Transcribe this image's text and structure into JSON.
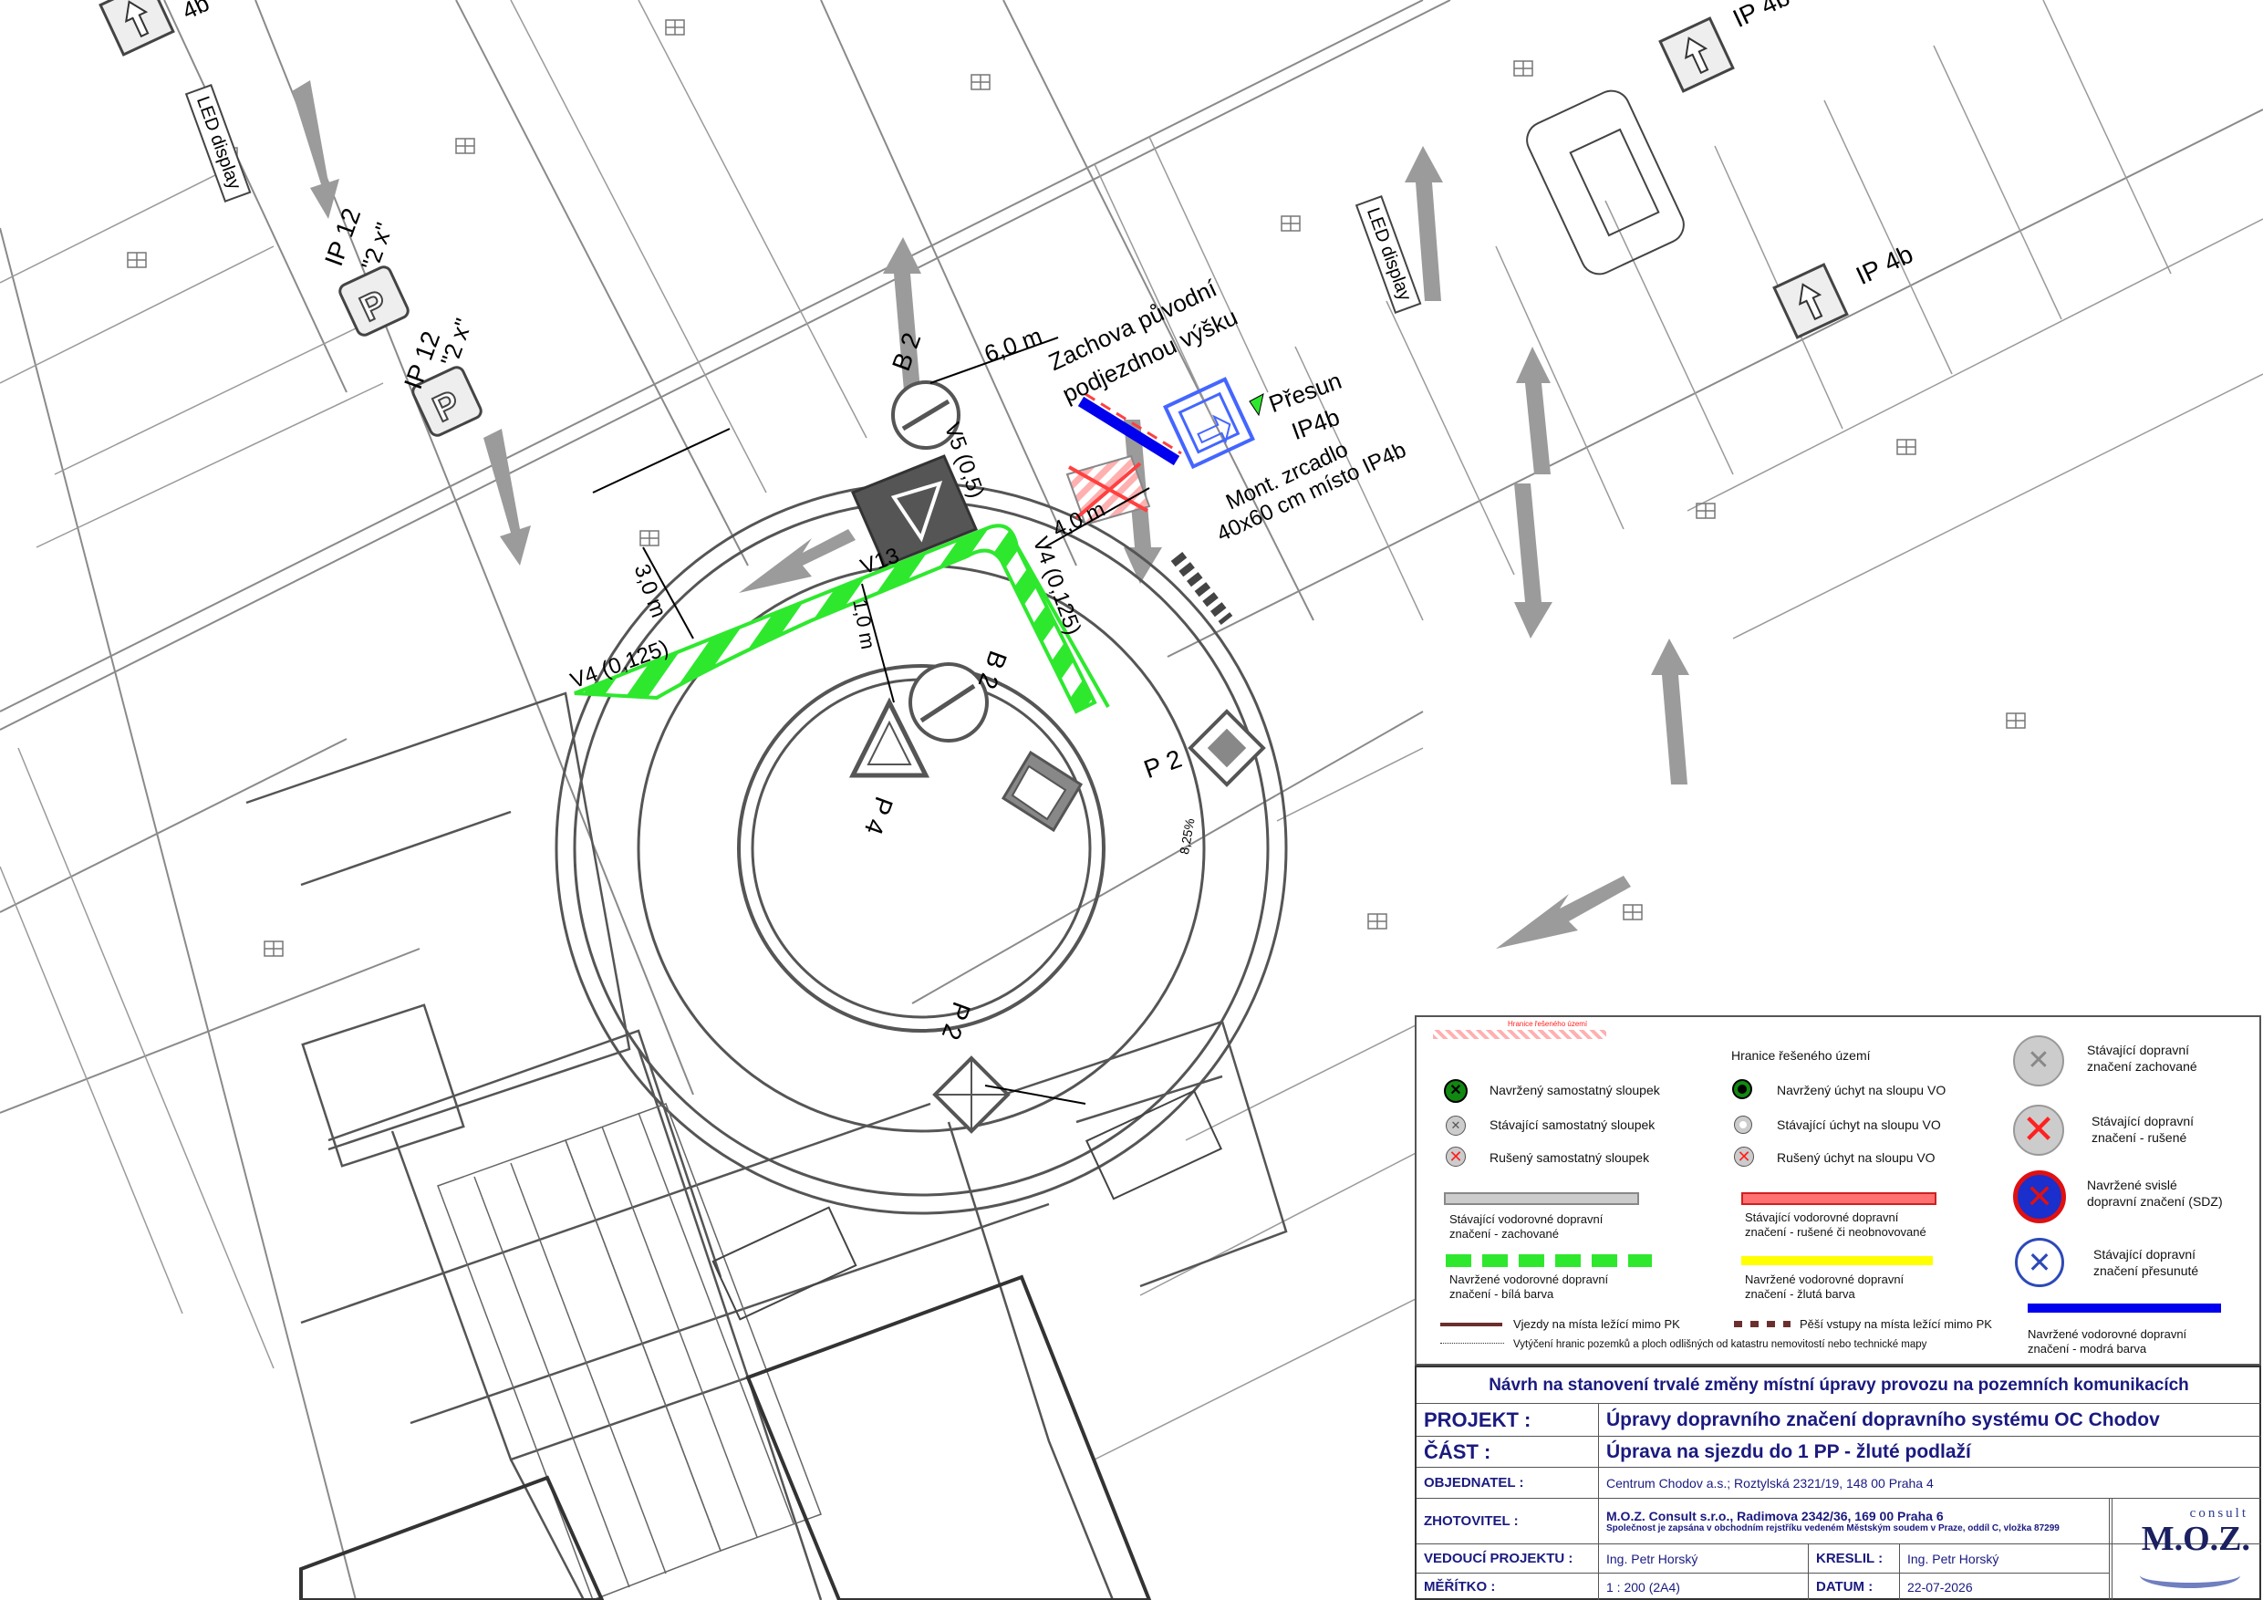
{
  "plan": {
    "signs": {
      "ip4b_a": "IP 4b",
      "ip4b_b": "IP 4b",
      "ip4b_c": "4b",
      "led_a": "LED display",
      "led_b": "LED display",
      "ip12_a": "IP 12",
      "ip12_a_qty": "\"2 x\"",
      "ip12_b": "IP 12",
      "ip12_b_qty": "\"2 x\"",
      "b2_a": "B 2",
      "b2_b": "B 2",
      "p2_a": "P 2",
      "p2_b": "P 2",
      "p4": "P 4",
      "slope": "8,25%"
    },
    "annotations": {
      "dim_6m": "6,0 m",
      "keep_height_1": "Zachova původní",
      "keep_height_2": "podjezdnou výšku",
      "move_1": "Přesun",
      "move_2": "IP4b",
      "mirror_1": "Mont. zrcadlo",
      "mirror_2": "40x60 cm místo IP4b",
      "dim_4m": "4,0 m",
      "v5": "V5 (0,5)",
      "v13": "V13",
      "dim_3m": "3,0 m",
      "dim_1m": "1,0 m",
      "v4_left": "V4 (0,125)",
      "v4_right": "V4 (0,125)"
    }
  },
  "legend": {
    "boundary_small": "Hranice řešeného území",
    "boundary": "Hranice řešeného území",
    "items": {
      "new_post": "Navržený samostatný sloupek",
      "exist_post": "Stávající samostatný sloupek",
      "removed_post": "Rušený samostatný sloupek",
      "new_mount": "Navržený úchyt na sloupu VO",
      "exist_mount": "Stávající úchyt na sloupu VO",
      "removed_mount": "Rušený úchyt na sloupu VO",
      "exist_sign_1": "Stávající dopravní",
      "exist_sign_2": "značení zachované",
      "cancel_sign_1": "Stávající dopravní",
      "cancel_sign_2": "značení - rušené",
      "new_vertical_1": "Navržené svislé",
      "new_vertical_2": "dopravní značení (SDZ)",
      "moved_sign_1": "Stávající dopravní",
      "moved_sign_2": "značení přesunuté",
      "h_exist_1": "Stávající vodorovné dopravní",
      "h_exist_2": "značení - zachované",
      "h_cancel_1": "Stávající vodorovné dopravní",
      "h_cancel_2": "značení - rušené či neobnovované",
      "h_white_1": "Navržené vodorovné dopravní",
      "h_white_2": "značení - bílá barva",
      "h_yellow_1": "Navržené vodorovné dopravní",
      "h_yellow_2": "značení - žlutá barva",
      "h_blue_1": "Navržené vodorovné dopravní",
      "h_blue_2": "značení - modrá barva",
      "entrances": "Vjezdy na místa ležící mimo PK",
      "pedestrian": "Pěší vstupy na místa ležící mimo PK",
      "survey": "Vytýčení hranic pozemků a ploch odlišných od katastru nemovitostí nebo technické mapy"
    },
    "colors": {
      "green": "#2ee82e",
      "red": "#ff4040",
      "yellow": "#ffff00",
      "blue": "#0000ee",
      "grey": "#cccccc",
      "brown": "#6b2f2f"
    }
  },
  "titleblock": {
    "header": "Návrh na stanovení trvalé změny místní úpravy provozu na pozemních komunikacích",
    "project_label": "PROJEKT :",
    "project_value": "Úpravy dopravního značení dopravního systému OC Chodov",
    "part_label": "ČÁST :",
    "part_value": "Úprava na sjezdu do 1 PP - žluté podlaží",
    "client_label": "OBJEDNATEL :",
    "client_value": "Centrum Chodov a.s.; Roztylská 2321/19, 148 00 Praha 4",
    "contractor_label": "ZHOTOVITEL :",
    "contractor_value": "M.O.Z. Consult s.r.o., Radimova 2342/36, 169 00 Praha 6",
    "contractor_note": "Společnost je zapsána v obchodním rejstříku vedeném Městským soudem v Praze, oddíl C, vložka 87299",
    "lead_label": "VEDOUCÍ PROJEKTU :",
    "lead_value": "Ing. Petr Horský",
    "drawn_label": "KRESLIL :",
    "drawn_value": "Ing. Petr Horský",
    "scale_label": "MĚŘÍTKO :",
    "scale_value": "1 : 200 (2A4)",
    "date_label": "DATUM :",
    "date_value": "22-07-2026",
    "logo_top": "consult",
    "logo_main": "M.O.Z."
  }
}
